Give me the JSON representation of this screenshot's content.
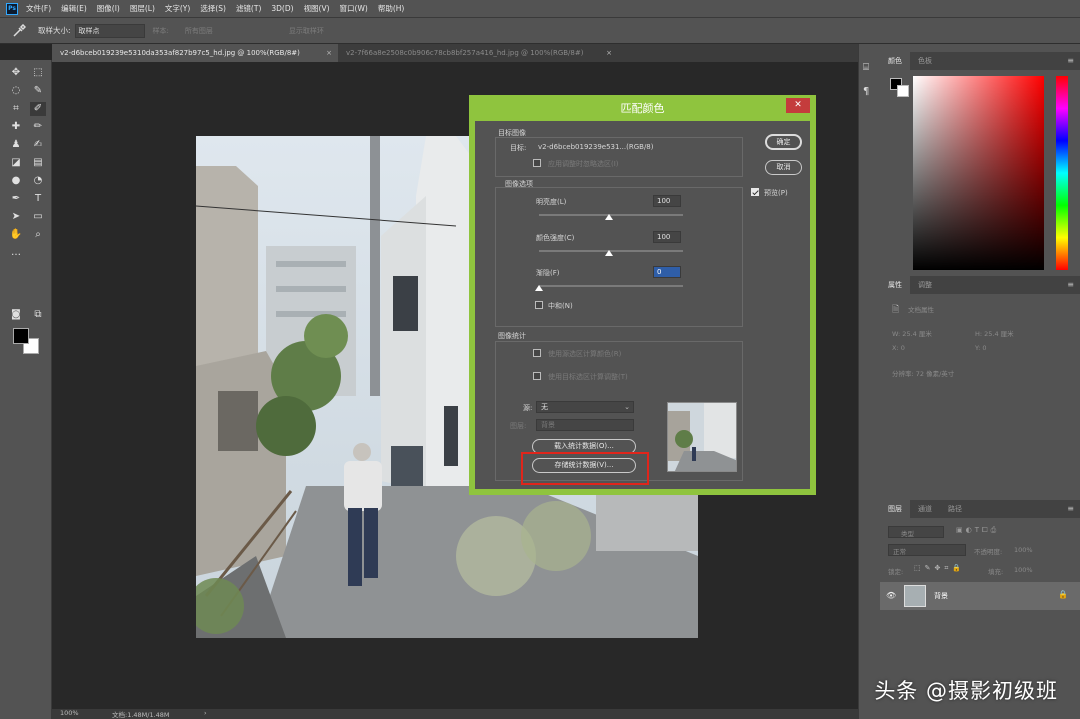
{
  "app": {
    "logo": "Ps",
    "menus": [
      "文件(F)",
      "编辑(E)",
      "图像(I)",
      "图层(L)",
      "文字(Y)",
      "选择(S)",
      "滤镜(T)",
      "3D(D)",
      "视图(V)",
      "窗口(W)",
      "帮助(H)"
    ]
  },
  "options": {
    "tool_icon": "eyedropper-icon",
    "sample_size_label": "取样大小:",
    "sample_size_value": "取样点",
    "dim_labels": [
      "样本:",
      "所有图层",
      "显示取样环"
    ]
  },
  "tabs": [
    {
      "label": "v2-d6bceb019239e5310da353af827b97c5_hd.jpg @ 100%(RGB/8#)",
      "active": true
    },
    {
      "label": "v2-7f66a8e2508c0b906c78cb8bf257a416_hd.jpg @ 100%(RGB/8#)",
      "active": false
    }
  ],
  "status": {
    "zoom": "100%",
    "doc": "文档:1.48M/1.48M"
  },
  "color_panel": {
    "tabs": [
      "颜色",
      "色板"
    ]
  },
  "properties_panel": {
    "tabs": [
      "属性",
      "调整"
    ],
    "doc_label": "文档属性",
    "w": "W: 25.4 厘米",
    "h": "H: 25.4 厘米",
    "x": "X: 0",
    "y": "Y: 0",
    "res": "分辨率: 72 像素/英寸"
  },
  "layers_panel": {
    "tabs": [
      "图层",
      "通道",
      "路径"
    ],
    "kind": "类型",
    "mode": "正常",
    "opacity_label": "不透明度:",
    "opacity": "100%",
    "lock_label": "锁定:",
    "fill_label": "填充:",
    "fill": "100%",
    "layer_name": "背景"
  },
  "dialog": {
    "title": "匹配颜色",
    "close_symbol": "✕",
    "target_group": "目标图像",
    "target_label": "目标:",
    "target_value": "v2-d6bceb019239e531...(RGB/8)",
    "ignore_selection": "应用调整时忽略选区(I)",
    "image_options": "图像选项",
    "luminance_label": "明亮度(L)",
    "luminance_value": "100",
    "color_intensity_label": "颜色强度(C)",
    "color_intensity_value": "100",
    "fade_label": "渐隐(F)",
    "fade_value": "0",
    "neutralize_label": "中和(N)",
    "stats_group": "图像统计",
    "use_source_selection": "使用源选区计算颜色(R)",
    "use_target_selection": "使用目标选区计算调整(T)",
    "source_label": "源:",
    "source_value": "无",
    "layer_label": "图层:",
    "layer_value": "背景",
    "load_button": "载入统计数据(O)...",
    "save_button": "存储统计数据(V)...",
    "ok_button": "确定",
    "cancel_button": "取消",
    "preview_label": "预览(P)",
    "preview_checked": true
  },
  "watermark": "头条 @摄影初级班",
  "colors": {
    "accent_border": "#8fc43e",
    "highlight_box": "#e0251b",
    "close_button": "#c43c3c"
  }
}
